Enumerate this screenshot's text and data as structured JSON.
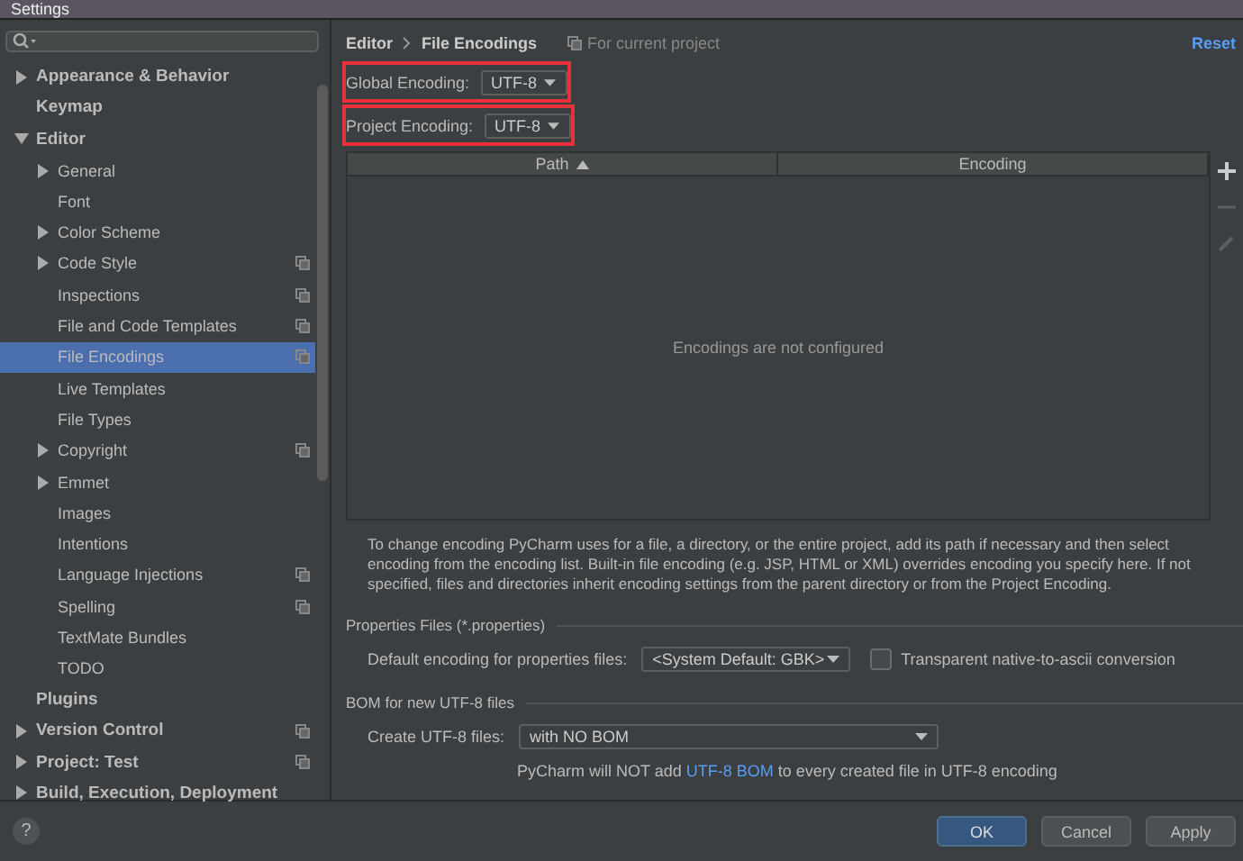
{
  "window": {
    "title": "Settings"
  },
  "sidebar": {
    "items": [
      {
        "label": "Appearance & Behavior",
        "expandable": true,
        "expanded": false,
        "selected": false,
        "project_icon": false
      },
      {
        "label": "Keymap",
        "expandable": false,
        "selected": false,
        "project_icon": false
      },
      {
        "label": "Editor",
        "expandable": true,
        "expanded": true,
        "selected": false,
        "project_icon": false,
        "children": [
          {
            "label": "General",
            "expandable": true,
            "expanded": false,
            "selected": false,
            "project_icon": false
          },
          {
            "label": "Font",
            "expandable": false,
            "selected": false,
            "project_icon": false
          },
          {
            "label": "Color Scheme",
            "expandable": true,
            "expanded": false,
            "selected": false,
            "project_icon": false
          },
          {
            "label": "Code Style",
            "expandable": true,
            "expanded": false,
            "selected": false,
            "project_icon": true
          },
          {
            "label": "Inspections",
            "expandable": false,
            "selected": false,
            "project_icon": true
          },
          {
            "label": "File and Code Templates",
            "expandable": false,
            "selected": false,
            "project_icon": true
          },
          {
            "label": "File Encodings",
            "expandable": false,
            "selected": true,
            "project_icon": true
          },
          {
            "label": "Live Templates",
            "expandable": false,
            "selected": false,
            "project_icon": false
          },
          {
            "label": "File Types",
            "expandable": false,
            "selected": false,
            "project_icon": false
          },
          {
            "label": "Copyright",
            "expandable": true,
            "expanded": false,
            "selected": false,
            "project_icon": true
          },
          {
            "label": "Emmet",
            "expandable": true,
            "expanded": false,
            "selected": false,
            "project_icon": false
          },
          {
            "label": "Images",
            "expandable": false,
            "selected": false,
            "project_icon": false
          },
          {
            "label": "Intentions",
            "expandable": false,
            "selected": false,
            "project_icon": false
          },
          {
            "label": "Language Injections",
            "expandable": false,
            "selected": false,
            "project_icon": true
          },
          {
            "label": "Spelling",
            "expandable": false,
            "selected": false,
            "project_icon": true
          },
          {
            "label": "TextMate Bundles",
            "expandable": false,
            "selected": false,
            "project_icon": false
          },
          {
            "label": "TODO",
            "expandable": false,
            "selected": false,
            "project_icon": false
          }
        ]
      },
      {
        "label": "Plugins",
        "expandable": false,
        "selected": false,
        "project_icon": false
      },
      {
        "label": "Version Control",
        "expandable": true,
        "expanded": false,
        "selected": false,
        "project_icon": true
      },
      {
        "label": "Project: Test",
        "expandable": true,
        "expanded": false,
        "selected": false,
        "project_icon": true
      },
      {
        "label": "Build, Execution, Deployment",
        "expandable": true,
        "expanded": false,
        "selected": false,
        "project_icon": false
      }
    ]
  },
  "breadcrumb": [
    "Editor",
    "File Encodings"
  ],
  "scope_note": "For current project",
  "reset_link": "Reset",
  "encodings": [
    {
      "label": "Global Encoding:",
      "value": "UTF-8",
      "highlighted": true
    },
    {
      "label": "Project Encoding:",
      "value": "UTF-8",
      "highlighted": true
    }
  ],
  "table": {
    "columns": [
      {
        "label": "Path",
        "sorted": true
      },
      {
        "label": "Encoding",
        "sorted": false
      }
    ],
    "empty_text": "Encodings are not configured"
  },
  "toolbar": [
    {
      "kind": "add",
      "disabled": false
    },
    {
      "kind": "remove",
      "disabled": true
    },
    {
      "kind": "edit",
      "disabled": true
    }
  ],
  "description": "To change encoding PyCharm uses for a file, a directory, or the entire project, add its path if necessary and then select encoding from the encoding list. Built-in file encoding (e.g. JSP, HTML or XML) overrides encoding you specify here. If not specified, files and directories inherit encoding settings from the parent directory or from the Project Encoding.",
  "properties": {
    "heading": "Properties Files (*.properties)",
    "label": "Default encoding for properties files:",
    "value": "<System Default: GBK>",
    "checkbox": {
      "label": "Transparent native-to-ascii conversion",
      "checked": false
    }
  },
  "bom": {
    "heading": "BOM for new UTF-8 files",
    "label": "Create UTF-8 files:",
    "value": "with NO BOM",
    "note_before": "PyCharm will NOT add ",
    "link": "UTF-8 BOM",
    "note_after": " to every created file in UTF-8 encoding"
  },
  "help": "?",
  "buttons": [
    {
      "label": "OK",
      "primary": true
    },
    {
      "label": "Cancel",
      "primary": false
    },
    {
      "label": "Apply",
      "primary": false
    }
  ]
}
